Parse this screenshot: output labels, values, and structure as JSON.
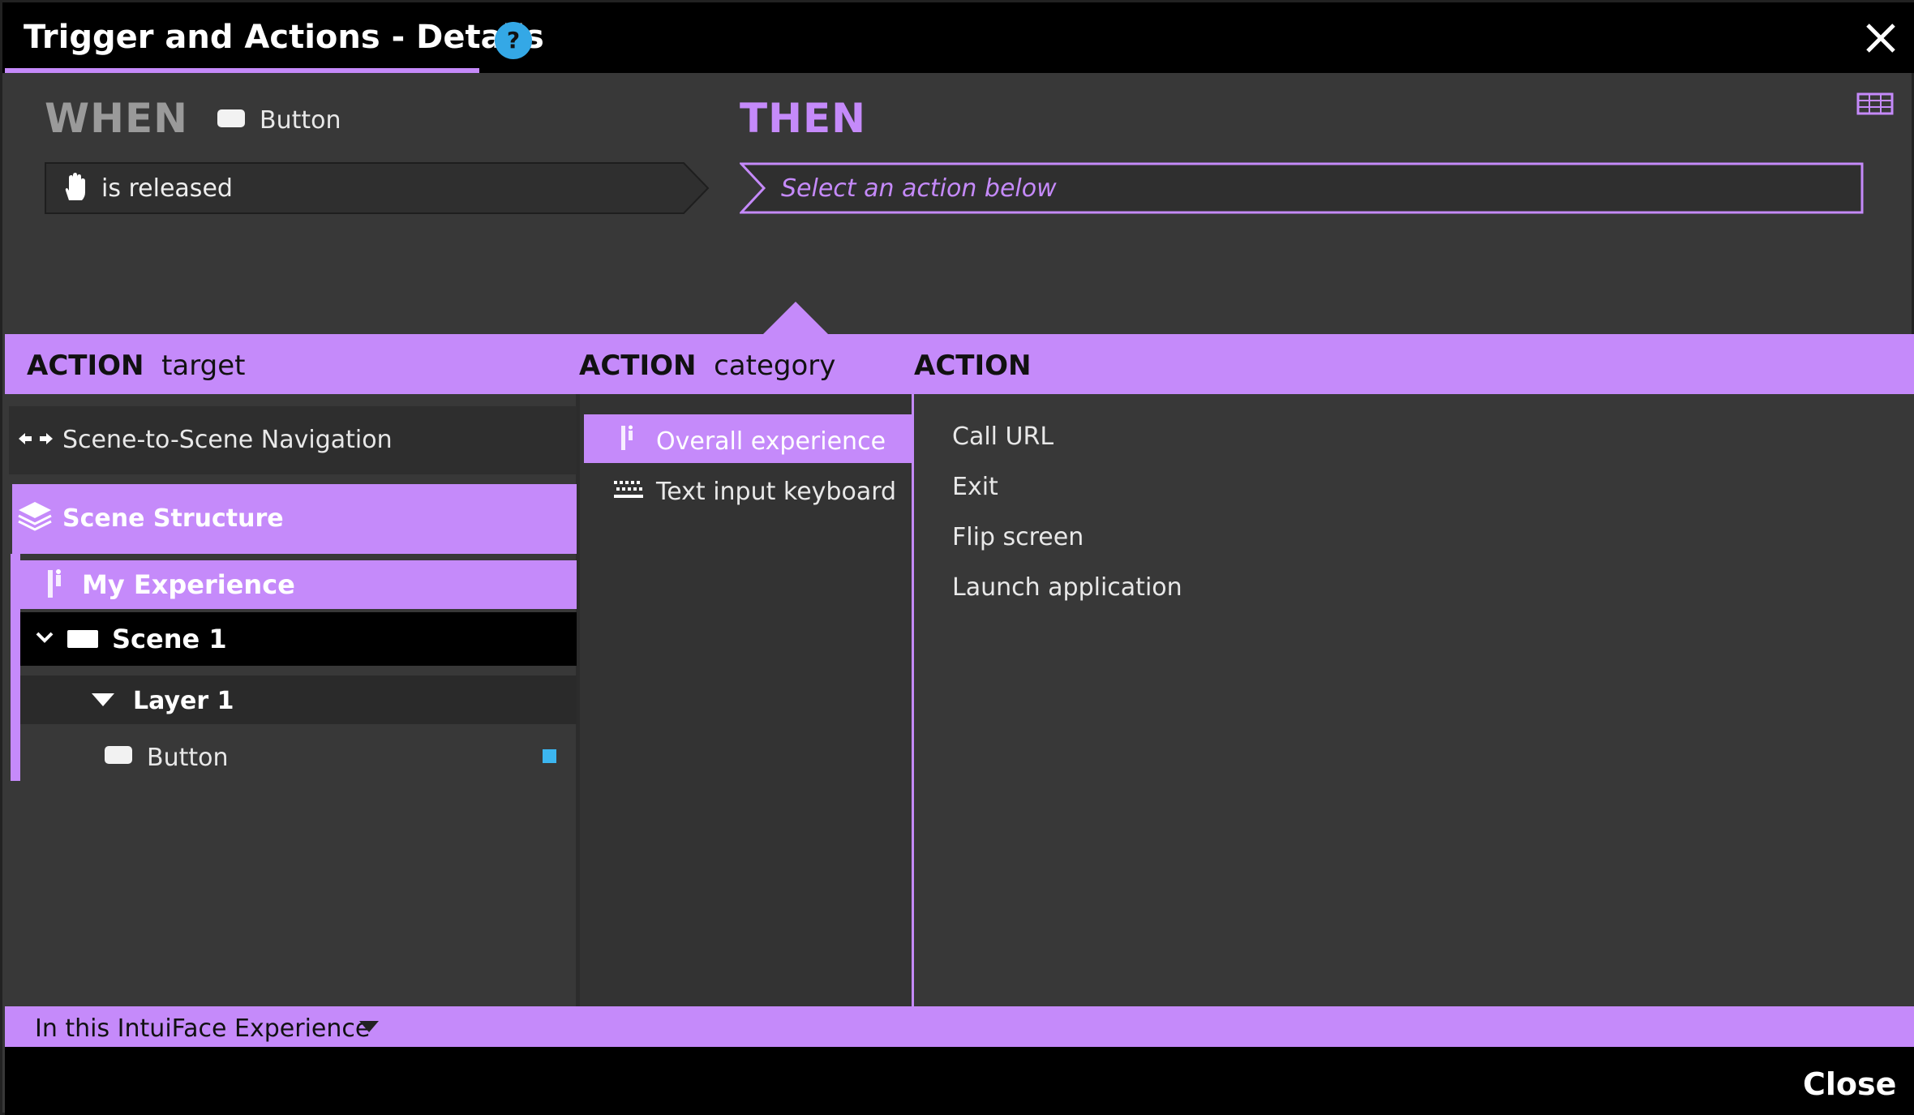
{
  "window": {
    "title": "Trigger and Actions - Details",
    "help_icon": "question-mark-icon",
    "help_glyph": "?",
    "close_icon": "close-icon"
  },
  "trigger": {
    "when_label": "WHEN",
    "source_icon": "button-icon",
    "source_name": "Button",
    "event_icon": "hand-icon",
    "event_label": "is released"
  },
  "action": {
    "then_label": "THEN",
    "placeholder": "Select an action below",
    "view_icon": "grid-view-icon"
  },
  "headers": {
    "target_bold": "ACTION",
    "target_rest": "target",
    "category_bold": "ACTION",
    "category_rest": "category",
    "action_bold": "ACTION"
  },
  "targets": {
    "navigation": {
      "icon": "arrows-left-right-icon",
      "label": "Scene-to-Scene Navigation"
    },
    "structure": {
      "icon": "layers-icon",
      "label": "Scene Structure"
    },
    "experience": {
      "icon": "experience-icon",
      "label": "My Experience"
    },
    "scene": {
      "icon": "scene-icon",
      "label": "Scene 1"
    },
    "layer": {
      "icon": "triangle-down-icon",
      "label": "Layer 1"
    },
    "button": {
      "icon": "button-icon",
      "label": "Button",
      "indicator_color": "#3cb6f0"
    }
  },
  "categories": [
    {
      "icon": "experience-icon",
      "label": "Overall experience",
      "selected": true
    },
    {
      "icon": "keyboard-icon",
      "label": "Text input keyboard",
      "selected": false
    }
  ],
  "actions": [
    "Call URL",
    "Exit",
    "Flip screen",
    "Launch application"
  ],
  "footer": {
    "scope_label": "In this IntuiFace Experience",
    "close_label": "Close"
  },
  "colors": {
    "accent": "#c58afa",
    "background": "#383838",
    "titlebar": "#000000",
    "help": "#34a8e6"
  }
}
